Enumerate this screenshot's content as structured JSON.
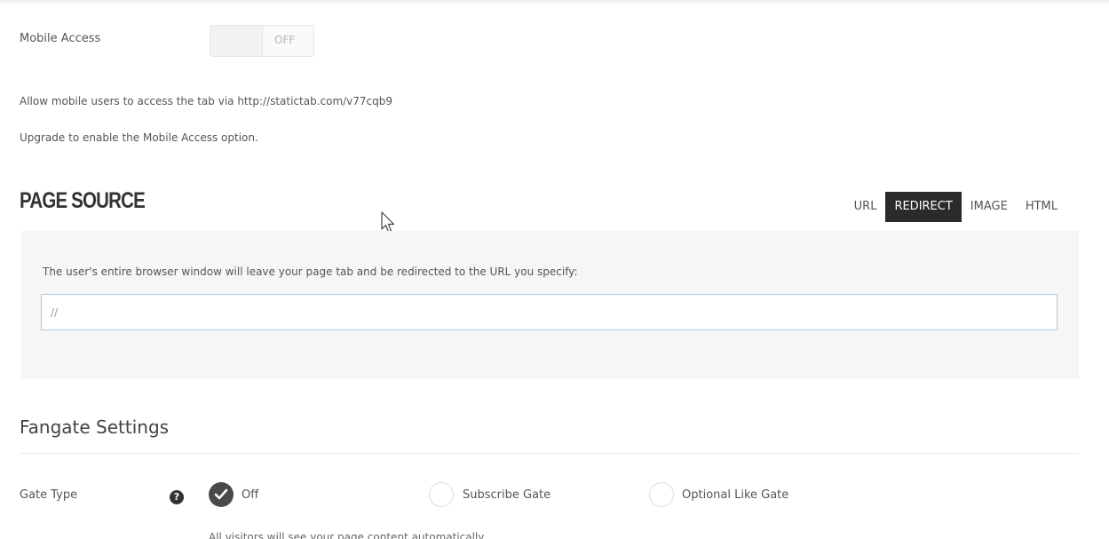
{
  "mobile": {
    "label": "Mobile Access",
    "toggle_state": "OFF",
    "allow_text": "Allow mobile users to access the tab via http://statictab.com/v77cqb9",
    "upgrade_text": "Upgrade to enable the Mobile Access option."
  },
  "page_source": {
    "title": "PAGE SOURCE",
    "tabs": [
      {
        "label": "URL",
        "active": false
      },
      {
        "label": "REDIRECT",
        "active": true
      },
      {
        "label": "IMAGE",
        "active": false
      },
      {
        "label": "HTML",
        "active": false
      }
    ],
    "description": "The user's entire browser window will leave your page tab and be redirected to the URL you specify:",
    "url_value": "//"
  },
  "fangate": {
    "title": "Fangate Settings",
    "gate_type_label": "Gate Type",
    "help_glyph": "?",
    "options": [
      {
        "label": "Off",
        "checked": true
      },
      {
        "label": "Subscribe Gate",
        "checked": false
      },
      {
        "label": "Optional Like Gate",
        "checked": false
      }
    ],
    "hint": "All visitors will see your page content automatically."
  },
  "colors": {
    "active_tab_bg": "#2b2b2b",
    "input_border": "#a9cbe6",
    "panel_bg": "#f6f6f6"
  }
}
